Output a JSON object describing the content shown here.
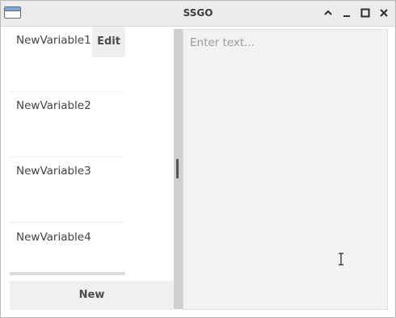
{
  "window": {
    "title": "SSGO"
  },
  "variables": [
    {
      "name": "NewVariable1",
      "edit_label": "Edit"
    },
    {
      "name": "NewVariable2"
    },
    {
      "name": "NewVariable3"
    },
    {
      "name": "NewVariable4"
    }
  ],
  "left_panel": {
    "new_label": "New"
  },
  "editor": {
    "placeholder": "Enter text...",
    "value": ""
  },
  "icons": {
    "app": "window-icon",
    "shade": "chevron-up-icon",
    "minimize": "minimize-icon",
    "maximize": "maximize-icon",
    "close": "close-icon",
    "cursor": "text-cursor-icon"
  }
}
